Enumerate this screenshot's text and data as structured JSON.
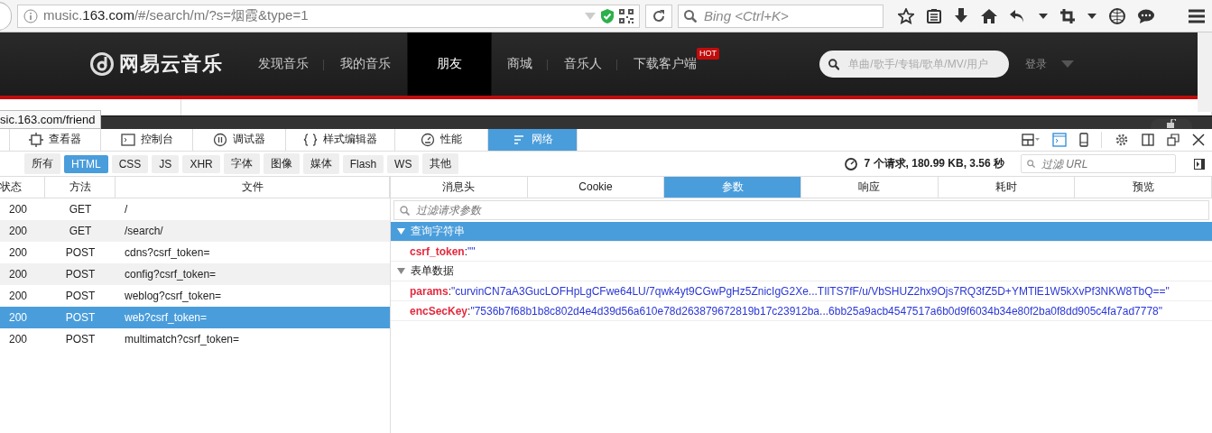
{
  "browser": {
    "url": {
      "prefix": "music.",
      "domain": "163.com",
      "path": "/#/search/m/?s=烟霞&type=1"
    },
    "search": {
      "placeholder": "Bing <Ctrl+K>"
    }
  },
  "site": {
    "logo": "网易云音乐",
    "nav": [
      {
        "label": "发现音乐",
        "selected": false
      },
      {
        "label": "我的音乐",
        "selected": false
      },
      {
        "label": "朋友",
        "selected": true
      },
      {
        "label": "商城",
        "selected": false
      },
      {
        "label": "音乐人",
        "selected": false
      },
      {
        "label": "下载客户端",
        "selected": false,
        "badge": "HOT"
      }
    ],
    "search": {
      "placeholder": "单曲/歌手/专辑/歌单/MV/用户"
    },
    "login": "登录"
  },
  "status_tooltip": "sic.163.com/friend",
  "devtools": {
    "tabs": [
      {
        "label": "查看器",
        "selected": false
      },
      {
        "label": "控制台",
        "selected": false
      },
      {
        "label": "调试器",
        "selected": false
      },
      {
        "label": "样式编辑器",
        "selected": false
      },
      {
        "label": "性能",
        "selected": false
      },
      {
        "label": "网络",
        "selected": true
      }
    ],
    "filters": [
      {
        "label": "所有",
        "selected": false
      },
      {
        "label": "HTML",
        "selected": true
      },
      {
        "label": "CSS",
        "selected": false
      },
      {
        "label": "JS",
        "selected": false
      },
      {
        "label": "XHR",
        "selected": false
      },
      {
        "label": "字体",
        "selected": false
      },
      {
        "label": "图像",
        "selected": false
      },
      {
        "label": "媒体",
        "selected": false
      },
      {
        "label": "Flash",
        "selected": false
      },
      {
        "label": "WS",
        "selected": false
      },
      {
        "label": "其他",
        "selected": false
      }
    ],
    "summary": "7 个请求, 180.99 KB, 3.56 秒",
    "url_filter": {
      "placeholder": "过滤 URL"
    },
    "table": {
      "columns": [
        "状态",
        "方法",
        "文件"
      ],
      "rows": [
        {
          "status": "200",
          "method": "GET",
          "file": "/",
          "selected": false
        },
        {
          "status": "200",
          "method": "GET",
          "file": "/search/",
          "selected": false
        },
        {
          "status": "200",
          "method": "POST",
          "file": "cdns?csrf_token=",
          "selected": false
        },
        {
          "status": "200",
          "method": "POST",
          "file": "config?csrf_token=",
          "selected": false
        },
        {
          "status": "200",
          "method": "POST",
          "file": "weblog?csrf_token=",
          "selected": false
        },
        {
          "status": "200",
          "method": "POST",
          "file": "web?csrf_token=",
          "selected": true
        },
        {
          "status": "200",
          "method": "POST",
          "file": "multimatch?csrf_token=",
          "selected": false
        }
      ]
    },
    "detail_tabs": [
      {
        "label": "消息头",
        "selected": false
      },
      {
        "label": "Cookie",
        "selected": false
      },
      {
        "label": "参数",
        "selected": true
      },
      {
        "label": "响应",
        "selected": false
      },
      {
        "label": "耗时",
        "selected": false
      },
      {
        "label": "预览",
        "selected": false
      }
    ],
    "param_filter": {
      "placeholder": "过滤请求参数"
    },
    "sections": [
      {
        "title": "查询字符串",
        "expanded": true,
        "selected": true,
        "params": [
          {
            "name": "csrf_token",
            "separator": ":",
            "value": "\"\""
          }
        ]
      },
      {
        "title": "表单数据",
        "expanded": true,
        "selected": false,
        "params": [
          {
            "name": "params",
            "separator": ":",
            "value": "\"curvinCN7aA3GucLOFHpLgCFwe64LU/7qwk4yt9CGwPgHz5ZnicIgG2Xe...TIlTS7fF/u/VbSHUZ2hx9Ojs7RQ3fZ5D+YMTlE1W5kXvPf3NKW8TbQ==\""
          },
          {
            "name": "encSecKey",
            "separator": ":",
            "value": "\"7536b7f68b1b8c802d4e4d39d56a610e78d263879672819b17c23912ba...6bb25a9acb4547517a6b0d9f6034b34e80f2ba0f8dd905c4fa7ad7778\""
          }
        ]
      }
    ]
  }
}
